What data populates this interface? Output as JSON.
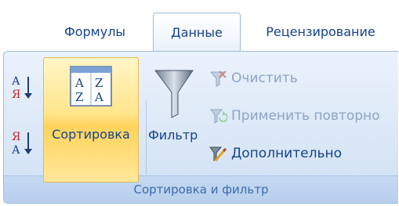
{
  "tabs": [
    {
      "label": "Формулы",
      "active": false
    },
    {
      "label": "Данные",
      "active": true
    },
    {
      "label": "Рецензирование",
      "active": false
    }
  ],
  "group": {
    "label": "Сортировка и фильтр",
    "sort_asc": {
      "top_letter": "А",
      "bottom_letter": "Я",
      "icon": "sort-a-to-z-icon"
    },
    "sort_desc": {
      "top_letter": "Я",
      "bottom_letter": "А",
      "icon": "sort-z-to-a-icon"
    },
    "sort_button": {
      "label": "Сортировка",
      "icon_letters": [
        "A",
        "Z",
        "Z",
        "A"
      ]
    },
    "filter_button": {
      "label": "Фильтр",
      "icon": "funnel-icon"
    },
    "commands": [
      {
        "label": "Очистить",
        "enabled": false,
        "icon": "clear-filter-icon"
      },
      {
        "label": "Применить повторно",
        "enabled": false,
        "icon": "reapply-filter-icon"
      },
      {
        "label": "Дополнительно",
        "enabled": true,
        "icon": "advanced-filter-icon"
      }
    ]
  },
  "colors": {
    "text": "#15428b",
    "disabled_text": "#8da4c3",
    "highlight": "#ffd35c",
    "ribbon": "#dce8f7"
  }
}
